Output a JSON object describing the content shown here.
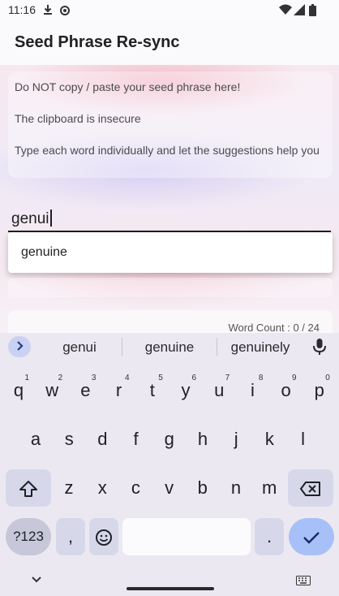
{
  "status": {
    "time": "11:16"
  },
  "app_bar": {
    "title": "Seed Phrase Re-sync"
  },
  "warning": {
    "line1": "Do NOT copy / paste your seed phrase here!",
    "line2": "The clipboard is insecure",
    "line3": "Type each word individually and let the suggestions help you"
  },
  "input": {
    "value": "genui"
  },
  "autocomplete": {
    "option": "genuine"
  },
  "footer": {
    "word_count": "Word Count : 0 / 24"
  },
  "keyboard": {
    "suggestions": [
      "genui",
      "genuine",
      "genuinely"
    ],
    "row1": [
      {
        "k": "q",
        "h": "1"
      },
      {
        "k": "w",
        "h": "2"
      },
      {
        "k": "e",
        "h": "3"
      },
      {
        "k": "r",
        "h": "4"
      },
      {
        "k": "t",
        "h": "5"
      },
      {
        "k": "y",
        "h": "6"
      },
      {
        "k": "u",
        "h": "7"
      },
      {
        "k": "i",
        "h": "8"
      },
      {
        "k": "o",
        "h": "9"
      },
      {
        "k": "p",
        "h": "0"
      }
    ],
    "row2": [
      "a",
      "s",
      "d",
      "f",
      "g",
      "h",
      "j",
      "k",
      "l"
    ],
    "row3": [
      "z",
      "x",
      "c",
      "v",
      "b",
      "n",
      "m"
    ],
    "sym_label": "?123",
    "comma": ",",
    "period": "."
  },
  "colors": {
    "accent": "#a8c0f8",
    "func_key": "#d6d8ea"
  },
  "icons": [
    "download-icon",
    "settings-icon",
    "wifi-icon",
    "signal-icon",
    "battery-icon",
    "chevron-right-icon",
    "mic-icon",
    "shift-icon",
    "backspace-icon",
    "emoji-icon",
    "check-icon",
    "chevron-down-icon",
    "keyboard-icon"
  ]
}
